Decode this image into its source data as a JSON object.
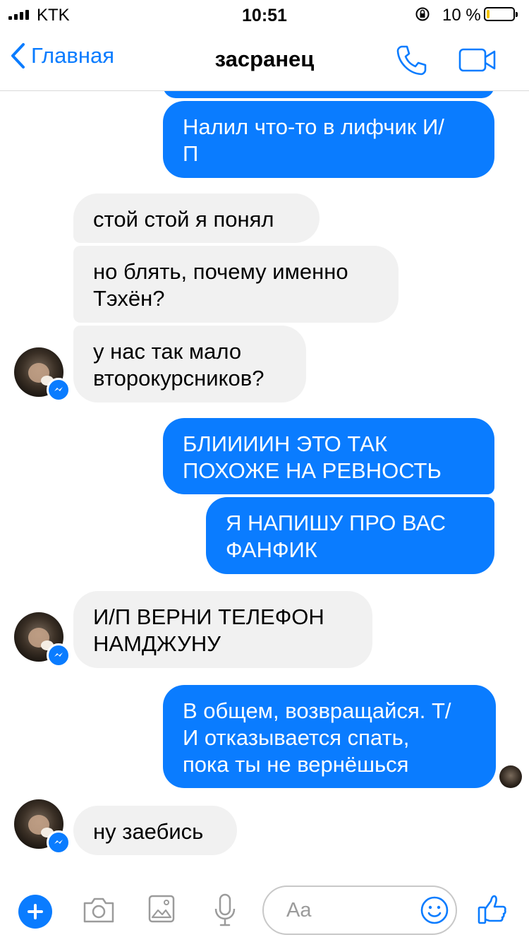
{
  "status_bar": {
    "carrier": "KTK",
    "time": "10:51",
    "battery_percent": "10 %",
    "battery_level": 0.1,
    "battery_color": "#f5c400"
  },
  "nav": {
    "back_label": "Главная",
    "title": "засранец",
    "icons": [
      "back-chevron-icon",
      "phone-icon",
      "video-camera-icon"
    ]
  },
  "messages": [
    {
      "direction": "out",
      "lines": [
        "Налил что-то в лифчик И/",
        "П"
      ]
    },
    {
      "direction": "in",
      "lines": [
        "стой стой я понял"
      ]
    },
    {
      "direction": "in",
      "lines": [
        "но блять, почему именно",
        "Тэхён?"
      ]
    },
    {
      "direction": "in",
      "lines": [
        "у нас так мало",
        "второкурсников?"
      ]
    },
    {
      "direction": "out",
      "lines": [
        "БЛИИИИН ЭТО ТАК",
        "ПОХОЖЕ НА РЕВНОСТЬ"
      ]
    },
    {
      "direction": "out",
      "lines": [
        "Я НАПИШУ ПРО ВАС",
        "ФАНФИК"
      ]
    },
    {
      "direction": "in",
      "lines": [
        "И/П ВЕРНИ ТЕЛЕФОН",
        "НАМДЖУНУ"
      ]
    },
    {
      "direction": "out",
      "lines": [
        "В общем, возвращайся. Т/",
        "И отказывается спать,",
        "пока ты не вернёшься"
      ]
    },
    {
      "direction": "in",
      "lines": [
        "ну заебись"
      ]
    }
  ],
  "composer": {
    "placeholder": "Aa",
    "icons": [
      "plus-icon",
      "camera-icon",
      "image-icon",
      "microphone-icon",
      "emoji-icon",
      "thumbs-up-icon"
    ]
  },
  "colors": {
    "accent": "#0a7cff",
    "incoming_bubble": "#f1f1f1",
    "outgoing_text": "#ffffff"
  }
}
